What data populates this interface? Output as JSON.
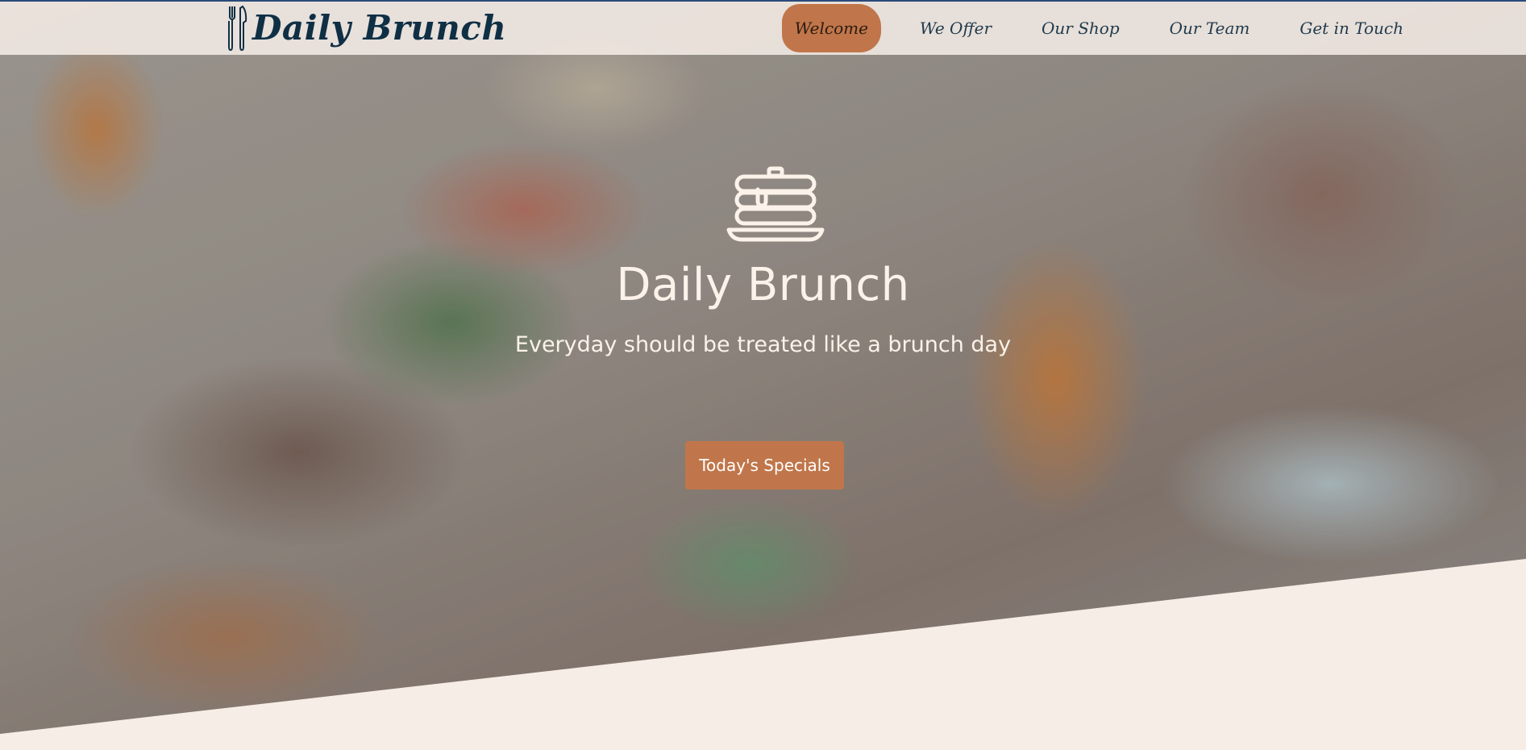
{
  "brand": {
    "name": "Daily Brunch",
    "icon": "fork-knife-icon"
  },
  "nav": {
    "items": [
      {
        "label": "Welcome",
        "active": true
      },
      {
        "label": "We Offer",
        "active": false
      },
      {
        "label": "Our Shop",
        "active": false
      },
      {
        "label": "Our Team",
        "active": false
      },
      {
        "label": "Get in Touch",
        "active": false
      }
    ]
  },
  "hero": {
    "icon": "pancake-stack-icon",
    "title": "Daily Brunch",
    "subtitle": "Everyday should be treated like a brunch day",
    "cta_label": "Today's Specials",
    "background": "brunch table photo"
  },
  "colors": {
    "accent": "#c0764a",
    "brand_text": "#0f2f45",
    "nav_text": "#1f3a4d",
    "page_bg": "#f6ede6",
    "hero_text": "#fbf2ea"
  }
}
